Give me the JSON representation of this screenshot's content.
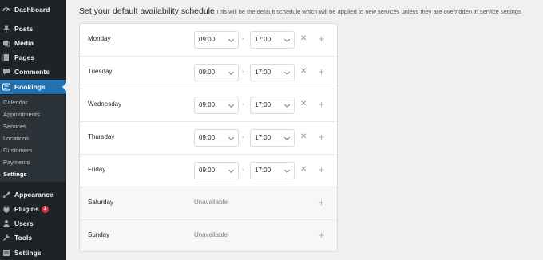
{
  "sidebar": {
    "items": [
      {
        "label": "Dashboard",
        "icon": "dashboard-icon"
      },
      {
        "label": "Posts",
        "icon": "pin-icon"
      },
      {
        "label": "Media",
        "icon": "media-icon"
      },
      {
        "label": "Pages",
        "icon": "pages-icon"
      },
      {
        "label": "Comments",
        "icon": "comment-icon"
      },
      {
        "label": "Bookings",
        "icon": "bookings-icon"
      },
      {
        "label": "Appearance",
        "icon": "brush-icon"
      },
      {
        "label": "Plugins",
        "icon": "plug-icon",
        "badge": "1"
      },
      {
        "label": "Users",
        "icon": "users-icon"
      },
      {
        "label": "Tools",
        "icon": "wrench-icon"
      },
      {
        "label": "Settings",
        "icon": "settings-icon"
      }
    ],
    "submenu": [
      "Calendar",
      "Appointments",
      "Services",
      "Locations",
      "Customers",
      "Payments",
      "Settings"
    ]
  },
  "header": {
    "title": "Set your default availability schedule",
    "description": "This will be the default schedule which will be applied to new services unless they are overridden in service settings"
  },
  "schedule": [
    {
      "day": "Monday",
      "start": "09:00",
      "end": "17:00"
    },
    {
      "day": "Tuesday",
      "start": "09:00",
      "end": "17:00"
    },
    {
      "day": "Wednesday",
      "start": "09:00",
      "end": "17:00"
    },
    {
      "day": "Thursday",
      "start": "09:00",
      "end": "17:00"
    },
    {
      "day": "Friday",
      "start": "09:00",
      "end": "17:00"
    },
    {
      "day": "Saturday",
      "status": "Unavailable"
    },
    {
      "day": "Sunday",
      "status": "Unavailable"
    }
  ],
  "symbols": {
    "dash": "-",
    "remove": "✕",
    "add": "+"
  },
  "colors": {
    "sidebar_bg": "#1d2327",
    "accent": "#2271b1",
    "badge": "#d63638"
  }
}
